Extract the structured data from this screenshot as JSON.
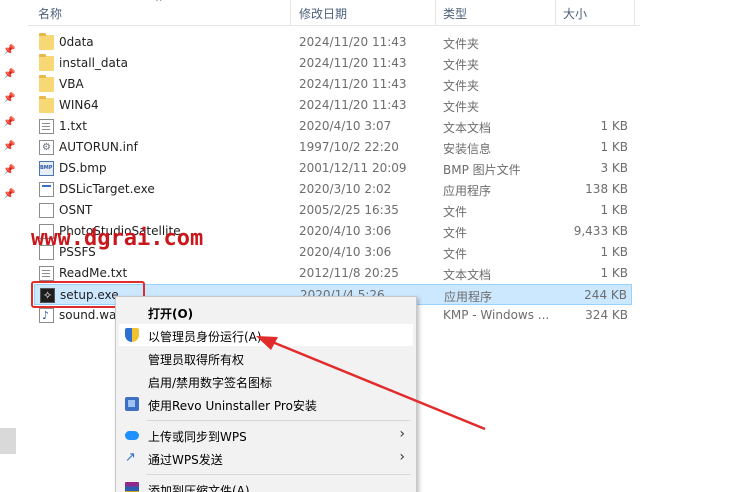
{
  "header": {
    "name": "名称",
    "date": "修改日期",
    "type": "类型",
    "size": "大小"
  },
  "files": [
    {
      "name": "0data",
      "date": "2024/11/20 11:43",
      "type": "文件夹",
      "size": "",
      "icon": "folder-icon"
    },
    {
      "name": "install_data",
      "date": "2024/11/20 11:43",
      "type": "文件夹",
      "size": "",
      "icon": "folder-icon"
    },
    {
      "name": "VBA",
      "date": "2024/11/20 11:43",
      "type": "文件夹",
      "size": "",
      "icon": "folder-icon"
    },
    {
      "name": "WIN64",
      "date": "2024/11/20 11:43",
      "type": "文件夹",
      "size": "",
      "icon": "folder-icon"
    },
    {
      "name": "1.txt",
      "date": "2020/4/10 3:07",
      "type": "文本文档",
      "size": "1 KB",
      "icon": "text-file-icon"
    },
    {
      "name": "AUTORUN.inf",
      "date": "1997/10/2 22:20",
      "type": "安装信息",
      "size": "1 KB",
      "icon": "setup-info-icon"
    },
    {
      "name": "DS.bmp",
      "date": "2001/12/11 20:09",
      "type": "BMP 图片文件",
      "size": "3 KB",
      "icon": "bmp-file-icon"
    },
    {
      "name": "DSLicTarget.exe",
      "date": "2020/3/10 2:02",
      "type": "应用程序",
      "size": "138 KB",
      "icon": "exe-file-icon"
    },
    {
      "name": "OSNT",
      "date": "2005/2/25 16:35",
      "type": "文件",
      "size": "1 KB",
      "icon": "blank-file-icon"
    },
    {
      "name": "PhotoStudioSatellite",
      "date": "2020/4/10 3:06",
      "type": "文件",
      "size": "9,433 KB",
      "icon": "blank-file-icon"
    },
    {
      "name": "PSSFS",
      "date": "2020/4/10 3:06",
      "type": "文件",
      "size": "1 KB",
      "icon": "blank-file-icon"
    },
    {
      "name": "ReadMe.txt",
      "date": "2012/11/8 20:25",
      "type": "文本文档",
      "size": "1 KB",
      "icon": "text-file-icon"
    },
    {
      "name": "setup.exe",
      "date": "2020/1/4 5:26",
      "type": "应用程序",
      "size": "244 KB",
      "icon": "setup-exe-icon"
    },
    {
      "name": "sound.wa",
      "date": "",
      "type": "KMP - Windows ...",
      "size": "324 KB",
      "icon": "audio-file-icon"
    }
  ],
  "watermark": "www.dgrai.com",
  "context_menu": {
    "open": "打开(O)",
    "run_as_admin": "以管理员身份运行(A)",
    "take_ownership": "管理员取得所有权",
    "toggle_signature": "启用/禁用数字签名图标",
    "revo_uninstall": "使用Revo Uninstaller Pro安装",
    "upload_wps": "上传或同步到WPS",
    "send_wps": "通过WPS发送",
    "add_archive": "添加到压缩文件(A)..."
  },
  "colors": {
    "selection": "#cce8ff",
    "highlight_box": "#e22b2b",
    "watermark": "#c8181e"
  }
}
